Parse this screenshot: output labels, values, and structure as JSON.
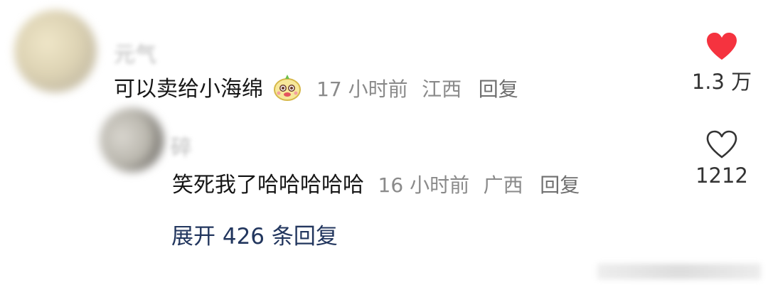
{
  "comments": [
    {
      "author": "元气",
      "text": "可以卖给小海绵",
      "has_emoji": true,
      "time": "17 小时前",
      "location": "江西",
      "reply_label": "回复",
      "likes": "1.3 万",
      "liked": true
    }
  ],
  "reply": {
    "author": "碎",
    "text": "笑死我了哈哈哈哈哈",
    "time": "16 小时前",
    "location": "广西",
    "reply_label": "回复",
    "likes": "1212",
    "liked": false
  },
  "expand": {
    "label": "展开 426 条回复"
  },
  "colors": {
    "like_active": "#f5333f",
    "link": "#22365e",
    "meta": "#8a8a8a"
  },
  "icons": {
    "emoji": "cute-face-emoji-icon",
    "like_active": "heart-filled-icon",
    "like_inactive": "heart-outline-icon"
  }
}
